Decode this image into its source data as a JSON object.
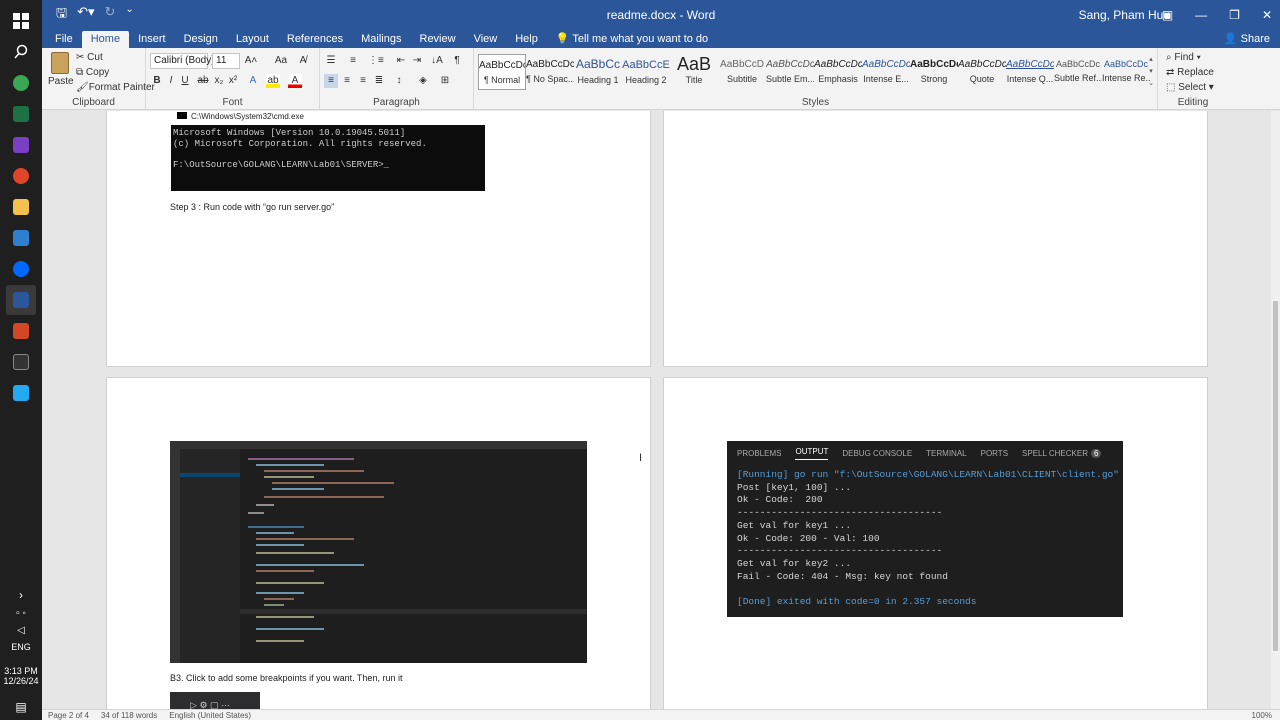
{
  "taskbar": {
    "icons": [
      "windows-icon",
      "search-icon",
      "chrome-icon",
      "excel-icon",
      "visual-studio-icon",
      "compass-icon",
      "file-explorer-icon",
      "remote-desktop-icon",
      "zalo-icon",
      "word-icon",
      "powerpoint-icon",
      "terminal-icon",
      "vscode-icon"
    ],
    "lang": "ENG",
    "time": "3:13 PM",
    "date": "12/26/24"
  },
  "titlebar": {
    "title": "readme.docx  -  Word",
    "user": "Sang, Pham Huu"
  },
  "tabs": [
    "File",
    "Home",
    "Insert",
    "Design",
    "Layout",
    "References",
    "Mailings",
    "Review",
    "View",
    "Help"
  ],
  "tell_me": "Tell me what you want to do",
  "share": "Share",
  "ribbon": {
    "clipboard": {
      "paste": "Paste",
      "cut": "Cut",
      "copy": "Copy",
      "format_painter": "Format Painter",
      "label": "Clipboard"
    },
    "font": {
      "name": "Calibri (Body)",
      "size": "11",
      "label": "Font"
    },
    "paragraph": {
      "label": "Paragraph"
    },
    "styles": {
      "label": "Styles",
      "items": [
        {
          "preview": "AaBbCcDc",
          "name": "¶ Normal"
        },
        {
          "preview": "AaBbCcDc",
          "name": "¶ No Spac..."
        },
        {
          "preview": "AaBbCc",
          "name": "Heading 1"
        },
        {
          "preview": "AaBbCcE",
          "name": "Heading 2"
        },
        {
          "preview": "AaB",
          "name": "Title"
        },
        {
          "preview": "AaBbCcD",
          "name": "Subtitle"
        },
        {
          "preview": "AaBbCcDc",
          "name": "Subtle Em..."
        },
        {
          "preview": "AaBbCcDc",
          "name": "Emphasis"
        },
        {
          "preview": "AaBbCcDc",
          "name": "Intense E..."
        },
        {
          "preview": "AaBbCcDc",
          "name": "Strong"
        },
        {
          "preview": "AaBbCcDc",
          "name": "Quote"
        },
        {
          "preview": "AaBbCcDc",
          "name": "Intense Q..."
        },
        {
          "preview": "AaBbCcDc",
          "name": "Subtle Ref..."
        },
        {
          "preview": "AaBbCcDc",
          "name": "Intense Re..."
        }
      ]
    },
    "editing": {
      "find": "Find",
      "replace": "Replace",
      "select": "Select",
      "label": "Editing"
    }
  },
  "document": {
    "cmd_title": "C:\\Windows\\System32\\cmd.exe",
    "cmd_lines": [
      "Microsoft Windows [Version 10.0.19045.5011]",
      "(c) Microsoft Corporation. All rights reserved.",
      "",
      "F:\\OutSource\\GOLANG\\LEARN\\Lab01\\SERVER>_"
    ],
    "step3": "Step 3 : Run code  with “go run server.go”",
    "b3": "B3. Click to add some breakpoints if you want. Then, run it",
    "output_panel": {
      "tabs": [
        "PROBLEMS",
        "OUTPUT",
        "DEBUG CONSOLE",
        "TERMINAL",
        "PORTS",
        "SPELL CHECKER"
      ],
      "active_tab": "OUTPUT",
      "badge": "6",
      "lines": [
        "[Running] go run \"f:\\OutSource\\GOLANG\\LEARN\\Lab01\\CLIENT\\client.go\"",
        "Post [key1, 100] ...",
        "Ok - Code:  200",
        "------------------------------------",
        "Get val for key1 ...",
        "Ok - Code: 200 - Val: 100",
        "------------------------------------",
        "Get val for key2 ...",
        "Fail - Code: 404 - Msg: key not found",
        "",
        "[Done] exited with code=0 in 2.357 seconds"
      ]
    }
  },
  "statusbar": {
    "page": "Page 2 of 4",
    "words": "34 of 118 words",
    "lang": "English (United States)",
    "zoom": "100%"
  },
  "colors": {
    "word_blue": "#2b579a",
    "running": "#569cd6",
    "done_num": "#b5cea8"
  }
}
